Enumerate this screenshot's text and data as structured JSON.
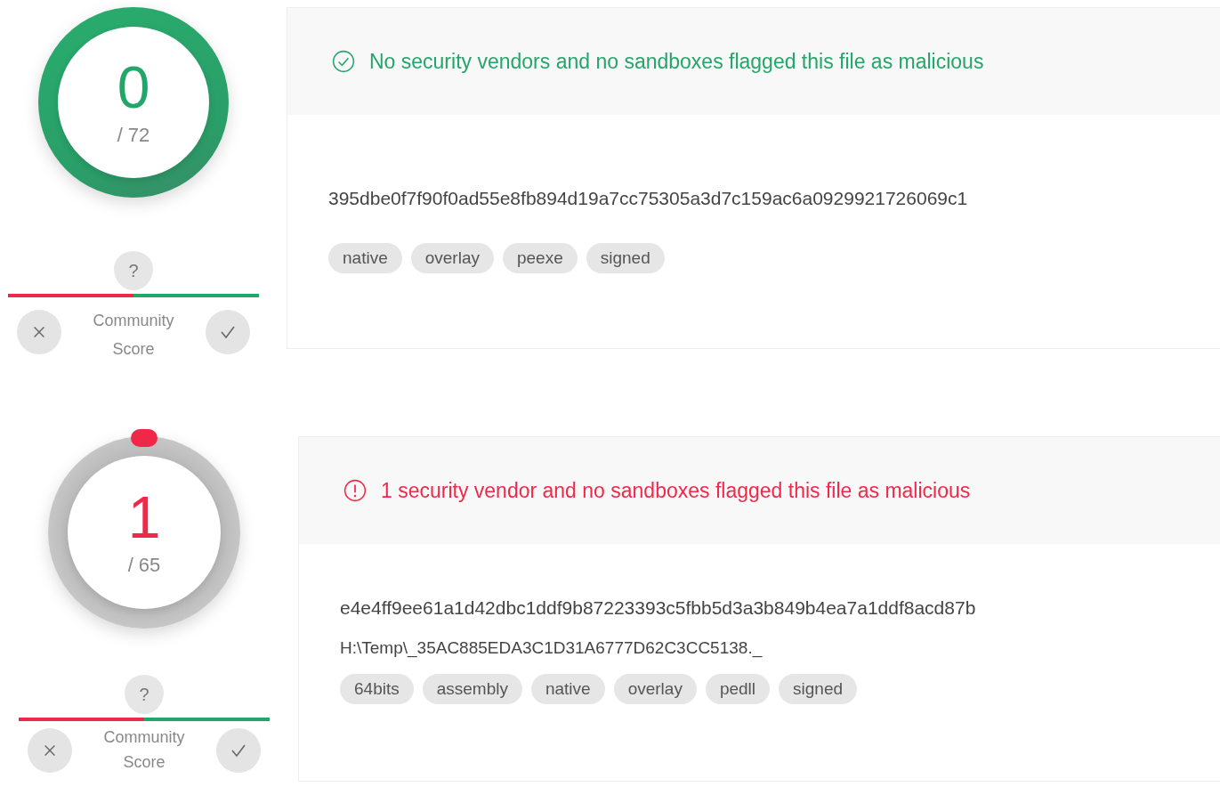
{
  "reports": [
    {
      "kind": "clean",
      "detections": "0",
      "total": "/ 72",
      "community": {
        "pin": "?",
        "label": "Community Score",
        "level": 0.5
      },
      "verdict": "No security vendors and no sandboxes flagged this file as malicious",
      "hash": "395dbe0f7f90f0ad55e8fb894d19a7cc75305a3d7c159ac6a0929921726069c1",
      "tags": [
        "native",
        "overlay",
        "peexe",
        "signed"
      ]
    },
    {
      "kind": "flagged",
      "detections": "1",
      "total": "/ 65",
      "community": {
        "pin": "?",
        "label": "Community Score",
        "level": 0.5
      },
      "verdict": "1 security vendor and no sandboxes flagged this file as malicious",
      "hash": "e4e4ff9ee61a1d42dbc1ddf9b87223393c5fbb5d3a3b849b4ea7a1ddf8acd87b",
      "path": "H:\\Temp\\_35AC885EDA3C1D31A6777D62C3CC5138._",
      "tags": [
        "64bits",
        "assembly",
        "native",
        "overlay",
        "pedll",
        "signed"
      ]
    }
  ]
}
